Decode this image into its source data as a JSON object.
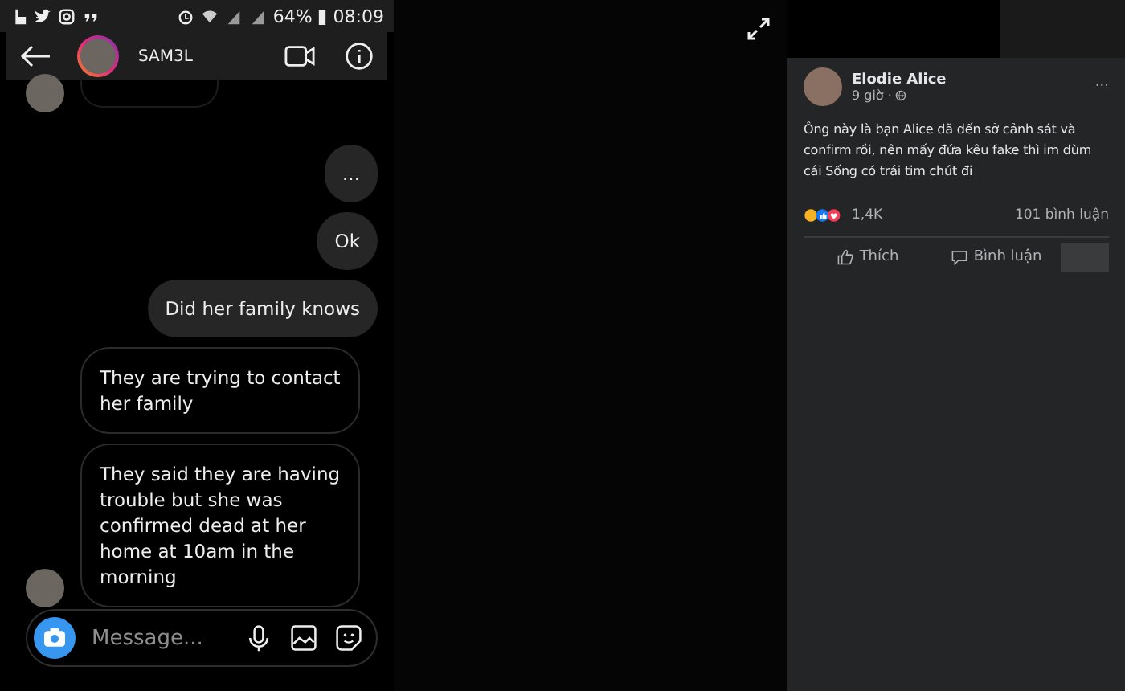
{
  "status_bar": {
    "battery": "64%",
    "time": "08:09"
  },
  "chat_header": {
    "username": "SAM3L"
  },
  "messages": [
    {
      "kind": "outgoing",
      "text": "..."
    },
    {
      "kind": "outgoing",
      "text": "Ok"
    },
    {
      "kind": "outgoing",
      "text": "Did her family knows"
    },
    {
      "kind": "incoming",
      "text": "They are trying to contact her family"
    },
    {
      "kind": "incoming",
      "text": "They said they are having trouble but she was confirmed dead at her home at 10am in the morning",
      "avatar": true
    }
  ],
  "composer": {
    "placeholder": "Message..."
  },
  "post": {
    "author": "Elodie Alice",
    "time": "9 giờ ·",
    "more": "···",
    "text": "Ông này là bạn Alice đã đến sở cảnh sát và confirm rồi, nên mấy đứa kêu fake thì im dùm cái Sống có trái tim chút đi",
    "reaction_count": "1,4K",
    "comment_count": "101 bình luận",
    "actions": [
      "Thích",
      "Bình luận"
    ]
  }
}
